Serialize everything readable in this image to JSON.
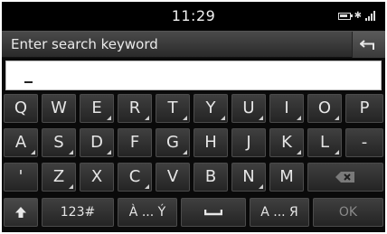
{
  "status_bar": {
    "time": "11:29"
  },
  "header": {
    "title": "Enter search keyword"
  },
  "search": {
    "value": ""
  },
  "keyboard": {
    "row1": [
      "Q",
      "W",
      "E",
      "R",
      "T",
      "Y",
      "U",
      "I",
      "O",
      "P"
    ],
    "row2": [
      "A",
      "S",
      "D",
      "F",
      "G",
      "H",
      "J",
      "K",
      "L",
      "-"
    ],
    "row3": [
      "'",
      "Z",
      "X",
      "C",
      "V",
      "B",
      "N",
      "M"
    ],
    "bottom": {
      "numbers": "123#",
      "accents": "À ... Ý",
      "alpha": "A ... Я",
      "ok": "OK"
    }
  },
  "icons": {
    "battery": "battery-icon",
    "bluetooth": "bluetooth-icon",
    "signal": "signal-icon",
    "back": "back-arrow-icon",
    "backspace": "backspace-icon",
    "shift": "shift-arrow-icon",
    "space": "space-bar-icon"
  }
}
